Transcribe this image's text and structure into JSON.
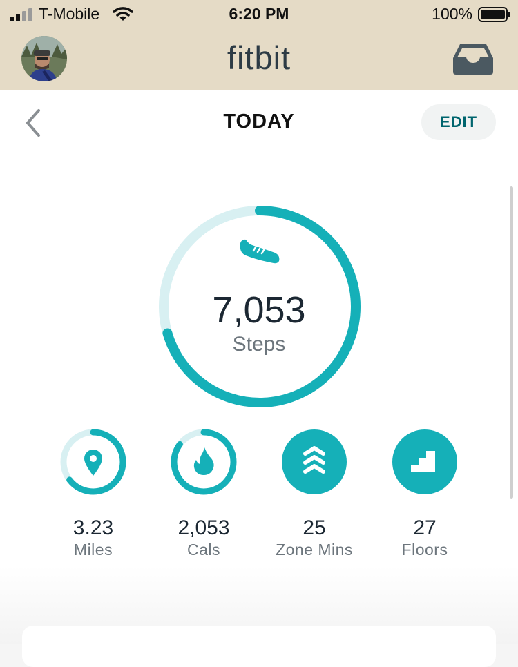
{
  "status_bar": {
    "carrier": "T-Mobile",
    "time": "6:20 PM",
    "battery_percent": "100%"
  },
  "header": {
    "logo": "fitbit",
    "avatar_icon": "user-avatar",
    "inbox_icon": "inbox-tray-icon"
  },
  "nav": {
    "back_icon": "chevron-left-icon",
    "title": "TODAY",
    "edit_label": "EDIT"
  },
  "steps": {
    "value": "7,053",
    "label": "Steps",
    "icon": "shoe-icon",
    "progress": 0.705
  },
  "stats": [
    {
      "value": "3.23",
      "label": "Miles",
      "icon": "location-pin-icon",
      "progress": 0.646
    },
    {
      "value": "2,053",
      "label": "Cals",
      "icon": "flame-icon",
      "progress": 0.85
    },
    {
      "value": "25",
      "label": "Zone Mins",
      "icon": "chevrons-up-icon",
      "progress": 1.0
    },
    {
      "value": "27",
      "label": "Floors",
      "icon": "stairs-icon",
      "progress": 1.0
    }
  ],
  "colors": {
    "accent": "#15b0b8",
    "track": "#d8f0f2",
    "header_bg": "#e5dbc6",
    "edit_text": "#00656e"
  }
}
